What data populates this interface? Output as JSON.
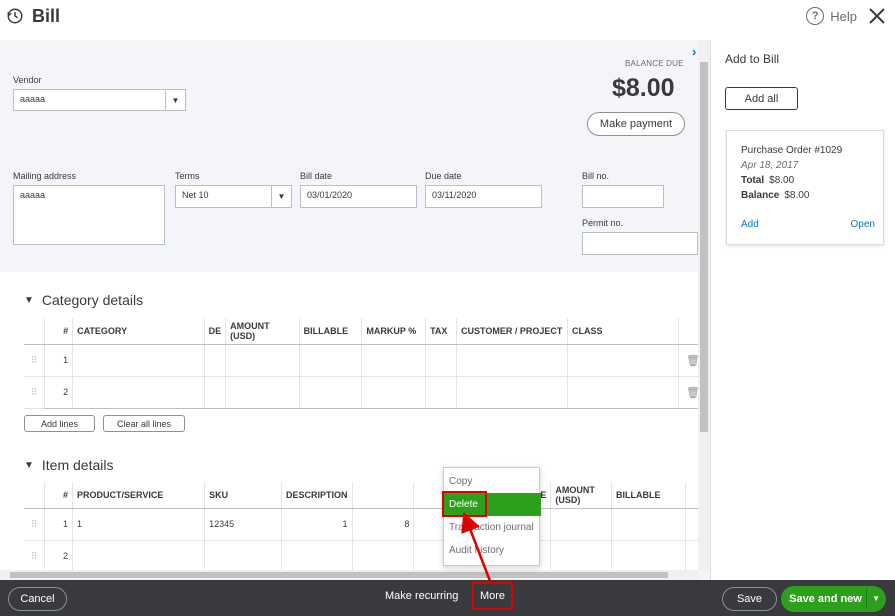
{
  "header": {
    "title": "Bill",
    "help_label": "Help"
  },
  "vendor": {
    "label": "Vendor",
    "value": "aaaaa"
  },
  "balance": {
    "label": "BALANCE DUE",
    "amount": "$8.00",
    "make_payment": "Make payment"
  },
  "mailing": {
    "label": "Mailing address",
    "value": "aaaaa"
  },
  "terms": {
    "label": "Terms",
    "value": "Net 10"
  },
  "bill_date": {
    "label": "Bill date",
    "value": "03/01/2020"
  },
  "due_date": {
    "label": "Due date",
    "value": "03/11/2020"
  },
  "bill_no": {
    "label": "Bill no.",
    "value": ""
  },
  "permit_no": {
    "label": "Permit no.",
    "value": ""
  },
  "category": {
    "title": "Category details",
    "columns": [
      "#",
      "CATEGORY",
      "DE",
      "AMOUNT (USD)",
      "BILLABLE",
      "MARKUP %",
      "TAX",
      "CUSTOMER / PROJECT",
      "CLASS"
    ],
    "rows": [
      {
        "num": "1"
      },
      {
        "num": "2"
      }
    ],
    "add_lines": "Add lines",
    "clear_lines": "Clear all lines"
  },
  "items": {
    "title": "Item details",
    "columns": [
      "#",
      "PRODUCT/SERVICE",
      "SKU",
      "DESCRIPTION",
      "E",
      "AMOUNT (USD)",
      "BILLABLE"
    ],
    "rows": [
      {
        "num": "1",
        "product": "1",
        "sku": "12345",
        "qty": "1",
        "rate": "8"
      },
      {
        "num": "2",
        "product": "",
        "sku": "",
        "qty": "",
        "rate": ""
      }
    ]
  },
  "panel": {
    "title": "Add to Bill",
    "add_all": "Add all",
    "card": {
      "title": "Purchase Order #1029",
      "date": "Apr 18, 2017",
      "total_label": "Total",
      "total": "$8.00",
      "balance_label": "Balance",
      "balance": "$8.00",
      "add": "Add",
      "open": "Open"
    }
  },
  "menu": {
    "items": [
      "Copy",
      "Delete",
      "Transaction journal",
      "Audit history"
    ]
  },
  "footer": {
    "cancel": "Cancel",
    "make_recurring": "Make recurring",
    "more": "More",
    "save": "Save",
    "save_new": "Save and new"
  },
  "colors": {
    "accent_green": "#2ca01c",
    "link_blue": "#0077c5",
    "highlight_red": "#e10000",
    "footer_bg": "#393a3d"
  }
}
